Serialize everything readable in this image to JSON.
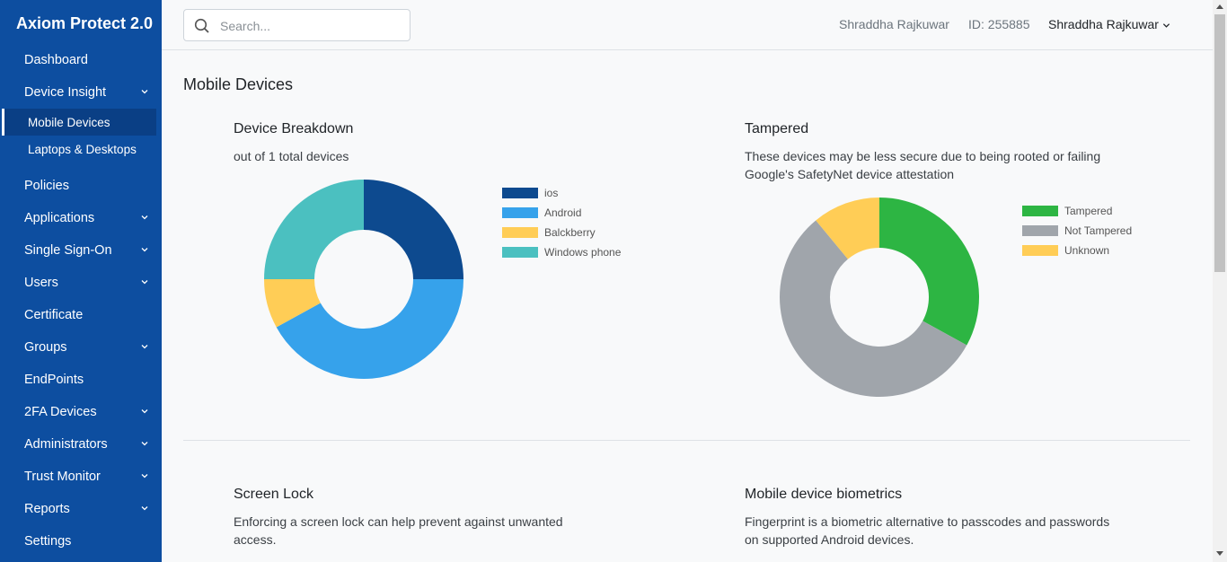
{
  "brand": "Axiom Protect 2.0",
  "sidebar": {
    "items": [
      {
        "label": "Dashboard",
        "expandable": false
      },
      {
        "label": "Device Insight",
        "expandable": true
      },
      {
        "label": "Policies",
        "expandable": false
      },
      {
        "label": "Applications",
        "expandable": true
      },
      {
        "label": "Single Sign-On",
        "expandable": true
      },
      {
        "label": "Users",
        "expandable": true
      },
      {
        "label": "Certificate",
        "expandable": false
      },
      {
        "label": "Groups",
        "expandable": true
      },
      {
        "label": "EndPoints",
        "expandable": false
      },
      {
        "label": "2FA Devices",
        "expandable": true
      },
      {
        "label": "Administrators",
        "expandable": true
      },
      {
        "label": "Trust Monitor",
        "expandable": true
      },
      {
        "label": "Reports",
        "expandable": true
      },
      {
        "label": "Settings",
        "expandable": false
      }
    ],
    "subitems": [
      {
        "label": "Mobile Devices",
        "active": true
      },
      {
        "label": "Laptops & Desktops",
        "active": false
      }
    ]
  },
  "header": {
    "search_placeholder": "Search...",
    "user_name": "Shraddha Rajkuwar",
    "user_id": "ID: 255885",
    "user_menu_label": "Shraddha Rajkuwar"
  },
  "main": {
    "page_title": "Mobile Devices",
    "breakdown": {
      "title": "Device Breakdown",
      "description": "out of 1 total devices"
    },
    "tampered": {
      "title": "Tampered",
      "description_line1": "These devices may be less secure due to being rooted or failing",
      "description_line2": "Google's SafetyNet device attestation"
    },
    "screen_lock": {
      "title": "Screen Lock",
      "description_line1": "Enforcing a screen lock can help prevent against unwanted",
      "description_line2": "access."
    },
    "biometrics": {
      "title": "Mobile device biometrics",
      "description_line1": "Fingerprint is a biometric alternative to passcodes and passwords",
      "description_line2": "on supported Android devices."
    }
  },
  "colors": {
    "sidebar_bg": "#0d4ea0",
    "ios": "#0d4a8f",
    "android": "#36a2eb",
    "blackberry": "#ffcd56",
    "windows_phone": "#4bc0c0",
    "tampered": "#2db543",
    "not_tampered": "#a0a5ab",
    "unknown": "#ffcd56"
  },
  "chart_data": [
    {
      "type": "pie",
      "title": "Device Breakdown",
      "categories": [
        "ios",
        "Android",
        "Balckberry",
        "Windows phone"
      ],
      "values": [
        25,
        42,
        8,
        25
      ],
      "colors": [
        "#0d4a8f",
        "#36a2eb",
        "#ffcd56",
        "#4bc0c0"
      ],
      "legend": "right",
      "donut": true
    },
    {
      "type": "pie",
      "title": "Tampered",
      "categories": [
        "Tampered",
        "Not Tampered",
        "Unknown"
      ],
      "values": [
        33,
        56,
        11
      ],
      "colors": [
        "#2db543",
        "#a0a5ab",
        "#ffcd56"
      ],
      "legend": "right",
      "donut": true
    }
  ]
}
